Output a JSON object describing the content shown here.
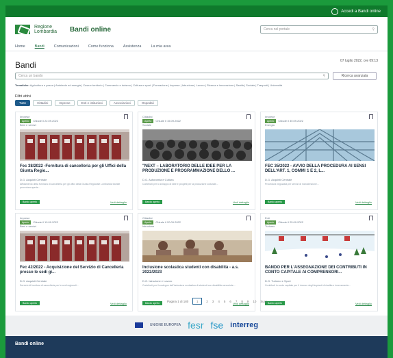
{
  "top_login": "Accedi a Bandi online",
  "brand": {
    "name": "Regione Lombardia",
    "app_title": "Bandi online"
  },
  "header_search_placeholder": "Cerca nel portale",
  "nav": [
    "Home",
    "Bandi",
    "Comunicazioni",
    "Come funziona",
    "Assistenza",
    "La mia area"
  ],
  "date": "07 luglio 2022, ore 09:13",
  "page_title": "Bandi",
  "main_search_placeholder": "Cerca un bando",
  "advanced_search": "Ricerca avanzata",
  "categories_label": "Tematiche:",
  "categories": [
    "Agricoltura e pesca",
    "Ambiente ed energia",
    "Casa e territorio",
    "Commercio e turismo",
    "Cultura e sport",
    "Formazione",
    "Imprese",
    "Istruzione",
    "Lavoro",
    "Ricerca e innovazione",
    "Sanità",
    "Sociale",
    "Trasporti",
    "Università"
  ],
  "filters_label": "Filtri attivi",
  "filters": [
    "Tutte",
    "Cittadini",
    "Imprese",
    "Enti e istituzioni",
    "Associazioni",
    "Ospedali"
  ],
  "cards": [
    {
      "type": "Imprese",
      "status_badge": "Aperto",
      "dates": "Chiude il 22.09.2022",
      "area": "Beni e servizi",
      "title": "Fec 38/2022 -Fornitura di cancelleria per gli Uffici della Giunta Regio...",
      "org": "D.G. Acquisti Centrale",
      "desc": "Affidamento della fornitura di cancelleria per gli uffici della Giunta Regionale Lombardia tramite procedura aperta...",
      "status": "Bando aperto",
      "detail": "Vedi dettaglio",
      "img": "binders"
    },
    {
      "type": "Cittadini",
      "status_badge": "Aperto",
      "dates": "Chiude il 15.09.2022",
      "area": "Sociale",
      "title": "\"NEXT – LABORATORIO DELLE IDEE PER LA PRODUZIONE E PROGRAMMAZIONE DELLO ...",
      "org": "D.G. Autonomia e Cultura",
      "desc": "Contributi per lo sviluppo di idee e progetti per la produzione culturale...",
      "status": "Bando aperto",
      "detail": "Vedi dettaglio",
      "img": "crowd"
    },
    {
      "type": "Imprese",
      "status_badge": "Aperto",
      "dates": "Chiude il 30.09.2022",
      "area": "Energia",
      "title": "FEC 35/2022 - AVVIO DELLA PROCEDURA AI SENSI DELL'ART. 1, COMMI 1 E 2, L...",
      "org": "D.G. Acquisti Centrale",
      "desc": "Procedura negoziata per servizi di manutenzione...",
      "status": "Bando aperto",
      "detail": "Vedi dettaglio",
      "img": "glass"
    },
    {
      "type": "Imprese",
      "status_badge": "Aperto",
      "dates": "Chiude il 10.09.2022",
      "area": "Beni e servizi",
      "title": "Fec 42/2022 - Acquisizione del Servizio di Cancelleria presso le sedi gi...",
      "org": "D.G. Acquisti Centrale",
      "desc": "Servizio di fornitura di cancelleria per le sedi regionali...",
      "status": "Bando aperto",
      "detail": "Vedi dettaglio",
      "img": "binders"
    },
    {
      "type": "Cittadini",
      "status_badge": "Aperto",
      "dates": "Chiude il 20.09.2022",
      "area": "Istruzione",
      "title": "Inclusione scolastica studenti con disabilità - a.s. 2022/2023",
      "org": "D.G. Istruzione e Lavoro",
      "desc": "Contributi per il sostegno dell'inclusione scolastica di studenti con disabilità sensoriale...",
      "status": "Bando aperto",
      "detail": "Vedi dettaglio",
      "img": "classroom"
    },
    {
      "type": "Enti",
      "status_badge": "Aperto",
      "dates": "Chiude il 25.09.2022",
      "area": "Turismo",
      "title": "BANDO PER L'ASSEGNAZIONE DEI CONTRIBUTI IN CONTO CAPITALE AI COMPRENSORI...",
      "org": "D.G. Turismo e Sport",
      "desc": "Contributi in conto capitale per il rinnovo degli impianti di risalita e innevamento...",
      "status": "Bando aperto",
      "detail": "Vedi dettaglio",
      "img": "ski"
    }
  ],
  "pagination": {
    "label": "Pagina 1 di 180",
    "pages": [
      "1",
      "2",
      "3",
      "4",
      "5",
      "6",
      "7",
      "8",
      "9",
      "10"
    ],
    "next": "Succ."
  },
  "logos": {
    "eu": "UNIONE EUROPEA",
    "fesr": "fesr",
    "fse": "fse",
    "interreg": "interreg"
  },
  "footer_title": "Bandi online"
}
